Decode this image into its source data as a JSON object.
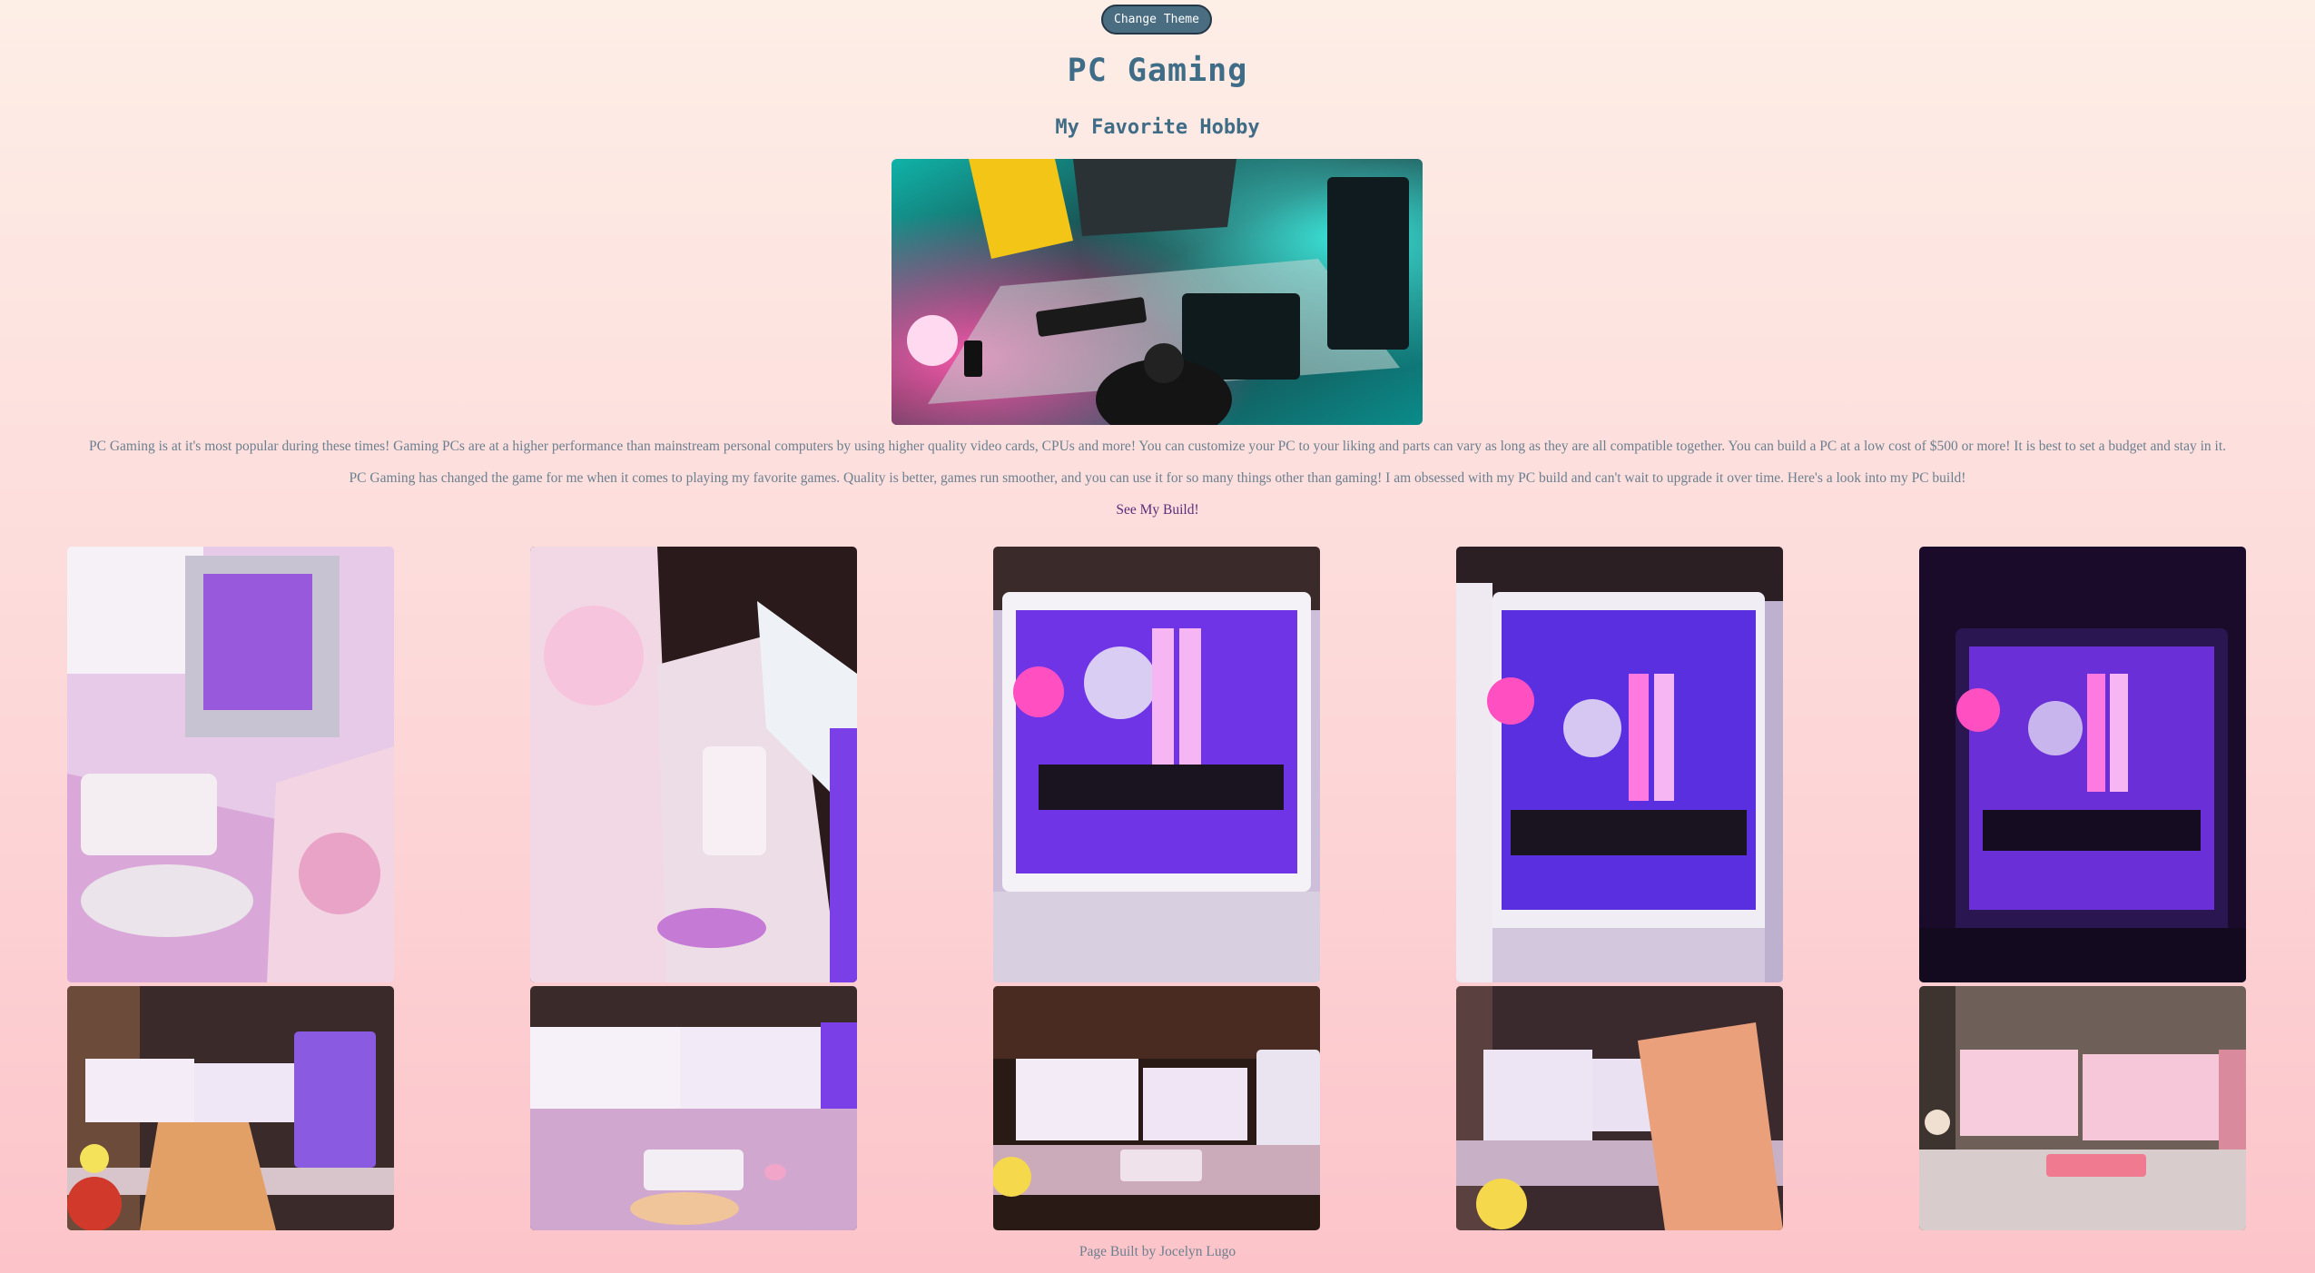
{
  "header": {
    "theme_button_label": "Change Theme",
    "title": "PC Gaming",
    "subtitle": "My Favorite Hobby"
  },
  "hero_image": {
    "alt": "Gamer at neon-lit desk with monitors",
    "colors": {
      "teal": "#23d3cc",
      "pink": "#ff3f9b",
      "yellow": "#f6c51a"
    }
  },
  "content": {
    "paragraph_1": "PC Gaming is at it's most popular during these times! Gaming PCs are at a higher performance than mainstream personal computers by using higher quality video cards, CPUs and more! You can customize your PC to your liking and parts can vary as long as they are all compatible together. You can build a PC at a low cost of $500 or more! It is best to set a budget and stay in it.",
    "paragraph_2": "PC Gaming has changed the game for me when it comes to playing my favorite games. Quality is better, games run smoother, and you can use it for so many things other than gaming! I am obsessed with my PC build and can't wait to upgrade it over time. Here's a look into my PC build!",
    "build_link": "See My Build!"
  },
  "gallery": {
    "row_1": [
      {
        "alt": "Pink desk setup with keyboard and bunny chair",
        "accent": "#c9a3d9"
      },
      {
        "alt": "Bunny chair beside desk and monitors",
        "accent": "#7a3fa0"
      },
      {
        "alt": "White PC case with purple RGB lighting",
        "accent": "#8b45e6"
      },
      {
        "alt": "PC case interior angled view with RGB",
        "accent": "#6a38e0"
      },
      {
        "alt": "PC case in dark room with purple glow",
        "accent": "#3c1760"
      }
    ],
    "row_2": [
      {
        "alt": "Dual monitors with gaming chair and PC",
        "accent": "#e8a06b"
      },
      {
        "alt": "Dual monitors with keyboard and mouse",
        "accent": "#d6a6c7"
      },
      {
        "alt": "Desk setup with dual monitors at night",
        "accent": "#b77a53"
      },
      {
        "alt": "Gaming chair facing dual monitors",
        "accent": "#9c7cb6"
      },
      {
        "alt": "Pink themed dual monitor setup",
        "accent": "#e98aa8"
      }
    ]
  },
  "footer": {
    "text": "Page Built by Jocelyn Lugo"
  }
}
